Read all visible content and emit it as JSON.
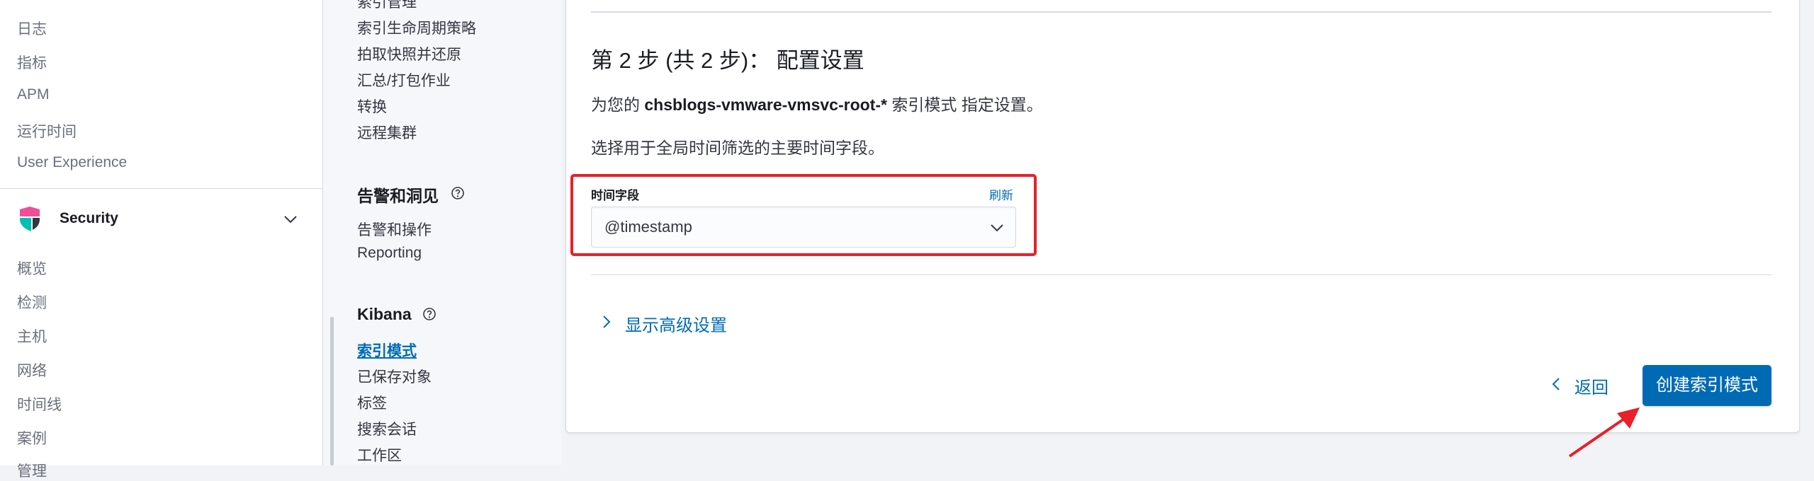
{
  "left_nav": {
    "items_top": [
      "日志",
      "指标",
      "APM",
      "运行时间",
      "User Experience"
    ],
    "security": {
      "title": "Security"
    },
    "security_items": [
      "概览",
      "检测",
      "主机",
      "网络",
      "时间线",
      "案例",
      "管理"
    ]
  },
  "mgmt_sidebar": {
    "data_items": [
      "索引管理",
      "索引生命周期策略",
      "拍取快照并还原",
      "汇总/打包作业",
      "转换",
      "远程集群"
    ],
    "alerts_heading": "告警和洞见",
    "alerts_items": [
      "告警和操作",
      "Reporting"
    ],
    "kibana_heading": "Kibana",
    "kibana_items": [
      "索引模式",
      "已保存对象",
      "标签",
      "搜索会话",
      "工作区"
    ]
  },
  "main": {
    "step_title": "第 2 步 (共 2 步)： 配置设置",
    "description_prefix": "为您的",
    "index_pattern": "chsblogs-vmware-vmsvc-root-*",
    "description_suffix": "索引模式 指定设置。",
    "time_hint": "选择用于全局时间筛选的主要时间字段。",
    "time_field_label": "时间字段",
    "refresh_label": "刷新",
    "time_field_value": "@timestamp",
    "advanced_label": "显示高级设置",
    "back_label": "返回",
    "create_label": "创建索引模式"
  },
  "colors": {
    "accent": "#006bb4",
    "highlight": "#e7202a",
    "security_logo": [
      "#f04e98",
      "#00bfb3",
      "#343741"
    ]
  },
  "icons": {
    "security_logo": "elastic-security-logo",
    "help": "question-circle-icon",
    "chevron_down": "chevron-down-icon",
    "chevron_right": "chevron-right-icon",
    "chevron_left": "chevron-left-icon"
  }
}
